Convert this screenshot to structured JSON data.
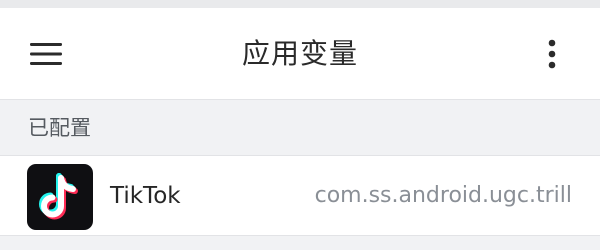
{
  "app_bar": {
    "title": "应用变量",
    "menu_icon": "hamburger-menu-icon",
    "overflow_icon": "more-vertical-icon"
  },
  "section": {
    "label": "已配置"
  },
  "apps": [
    {
      "name": "TikTok",
      "package": "com.ss.android.ugc.trill",
      "icon": "tiktok-logo-icon"
    }
  ],
  "colors": {
    "background": "#f1f2f4",
    "surface": "#ffffff",
    "title_text": "#2a2a2a",
    "secondary_text": "#8a8f96",
    "tiktok_cyan": "#25f4ee",
    "tiktok_red": "#fe2c55"
  }
}
